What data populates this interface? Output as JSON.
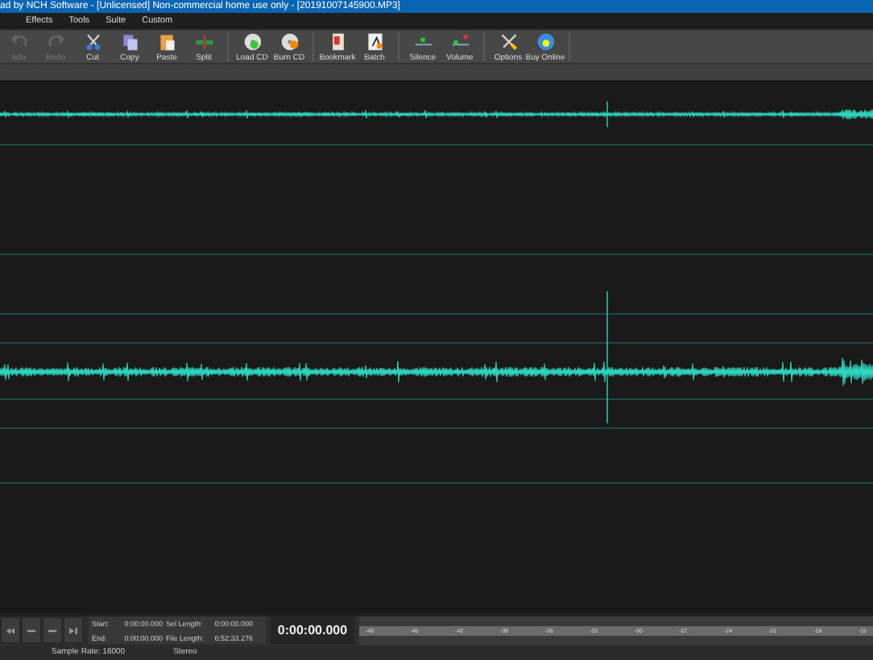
{
  "window": {
    "title": "ad by NCH Software - [Unlicensed] Non-commercial home use only - [20191007145900.MP3]"
  },
  "menu": [
    "Effects",
    "Tools",
    "Suite",
    "Custom"
  ],
  "toolbar": {
    "groups": [
      [
        {
          "label": "ndo",
          "disabled": true
        },
        {
          "label": "Redo",
          "disabled": true
        },
        {
          "label": "Cut",
          "disabled": false
        },
        {
          "label": "Copy",
          "disabled": false
        },
        {
          "label": "Paste",
          "disabled": false
        },
        {
          "label": "Split",
          "disabled": false
        }
      ],
      [
        {
          "label": "Load CD",
          "disabled": false
        },
        {
          "label": "Burn CD",
          "disabled": false
        }
      ],
      [
        {
          "label": "Bookmark",
          "disabled": false
        },
        {
          "label": "Batch",
          "disabled": false
        }
      ],
      [
        {
          "label": "Silence",
          "disabled": false
        },
        {
          "label": "Volume",
          "disabled": false
        }
      ],
      [
        {
          "label": "Options",
          "disabled": false
        },
        {
          "label": "Buy Online",
          "disabled": false
        }
      ]
    ]
  },
  "selection": [
    {
      "label": "Start:",
      "value": "0:00:00.000"
    },
    {
      "label": "Sel Length:",
      "value": "0:00:00.000"
    },
    {
      "label": "End:",
      "value": "0:00:00.000"
    },
    {
      "label": "File Length:",
      "value": "6:52:33.276"
    }
  ],
  "time_display": "0:00:00.000",
  "meter_scale": [
    "-48",
    "-45",
    "-42",
    "-39",
    "-36",
    "-33",
    "-30",
    "-27",
    "-24",
    "-21",
    "-18",
    "-15"
  ],
  "status_bar": {
    "sample_rate": "Sample Rate: 16000",
    "channels": "Stereo"
  }
}
